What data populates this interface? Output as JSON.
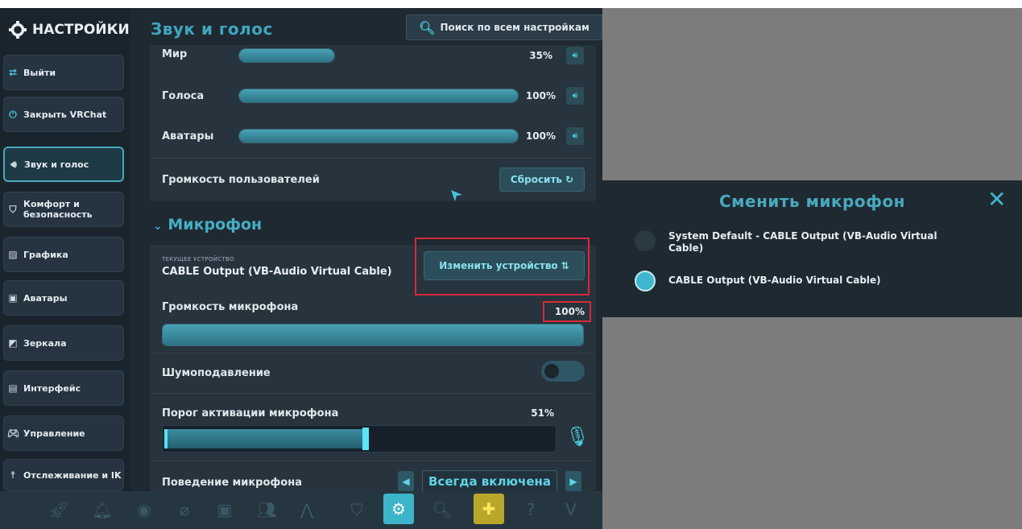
{
  "sidebar": {
    "title": "НАСТРОЙКИ",
    "items": [
      {
        "label": "Выйти",
        "icon": "exit-icon"
      },
      {
        "label": "Закрыть VRChat",
        "icon": "power-icon"
      },
      {
        "label": "Звук и голос",
        "icon": "speaker-icon",
        "active": true
      },
      {
        "label": "Комфорт и безопасность",
        "icon": "shield-icon"
      },
      {
        "label": "Графика",
        "icon": "image-icon"
      },
      {
        "label": "Аватары",
        "icon": "avatar-icon"
      },
      {
        "label": "Зеркала",
        "icon": "mirror-icon"
      },
      {
        "label": "Интерфейс",
        "icon": "interface-icon"
      },
      {
        "label": "Управление",
        "icon": "gamepad-icon"
      },
      {
        "label": "Отслеживание и IK",
        "icon": "tracking-icon"
      }
    ]
  },
  "header": {
    "title": "Звук и голос",
    "search_label": "Поиск по всем настройкам"
  },
  "volume": {
    "rows": [
      {
        "label": "Мир",
        "value": 35,
        "pct": "35%"
      },
      {
        "label": "Голоса",
        "value": 100,
        "pct": "100%"
      },
      {
        "label": "Аватары",
        "value": 100,
        "pct": "100%"
      }
    ],
    "user_volume_label": "Громкость пользователей",
    "reset_label": "Сбросить"
  },
  "microphone": {
    "section_title": "Микрофон",
    "current_device_caption": "ТЕКУЩЕЕ УСТРОЙСТВО",
    "current_device": "CABLE Output (VB-Audio Virtual Cable)",
    "change_device_label": "Изменить устройство",
    "mic_volume_label": "Громкость микрофона",
    "mic_volume_pct": "100%",
    "mic_volume_value": 100,
    "noise_suppression_label": "Шумоподавление",
    "noise_suppression_on": false,
    "threshold_label": "Порог активации микрофона",
    "threshold_pct": "51%",
    "threshold_value": 51,
    "behavior_label": "Поведение микрофона",
    "behavior_value": "Всегда включена"
  },
  "popup": {
    "title": "Сменить микрофон",
    "options": [
      {
        "label": "System Default - CABLE Output (VB-Audio Virtual Cable)",
        "selected": false
      },
      {
        "label": "CABLE Output (VB-Audio Virtual Cable)",
        "selected": true
      }
    ]
  },
  "colors": {
    "accent": "#3fa7bd",
    "panel": "#27333d",
    "highlight_box": "#d62b3a",
    "backdrop": "#7c7c7c"
  }
}
